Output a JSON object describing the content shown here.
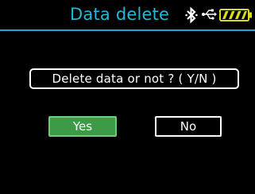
{
  "header": {
    "title": "Data delete",
    "title_color": "#22b8d8",
    "rule_color": "#1aa9c6",
    "icons": [
      "bluetooth-icon",
      "usb-icon",
      "battery-icon"
    ],
    "battery_color": "#d9d92a"
  },
  "dialog": {
    "prompt": "Delete data or not ?  ( Y/N )",
    "yes_label": "Yes",
    "no_label": "No",
    "yes_color": "#3d9a47",
    "selected": "Yes"
  }
}
